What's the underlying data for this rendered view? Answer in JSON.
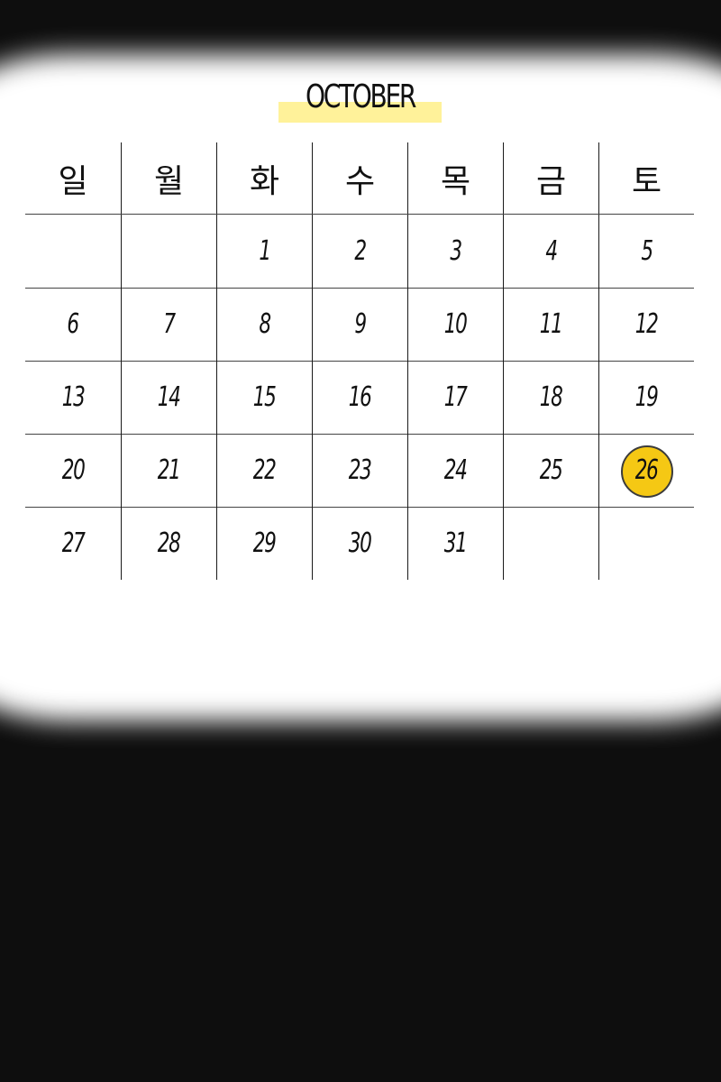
{
  "calendar": {
    "month": "OCTOBER",
    "weekdays": [
      "일",
      "월",
      "화",
      "수",
      "목",
      "금",
      "토"
    ],
    "weeks": [
      [
        "",
        "",
        "1",
        "2",
        "3",
        "4",
        "5"
      ],
      [
        "6",
        "7",
        "8",
        "9",
        "10",
        "11",
        "12"
      ],
      [
        "13",
        "14",
        "15",
        "16",
        "17",
        "18",
        "19"
      ],
      [
        "20",
        "21",
        "22",
        "23",
        "24",
        "25",
        "26"
      ],
      [
        "27",
        "28",
        "29",
        "30",
        "31",
        "",
        ""
      ]
    ],
    "highlighted_day": "26",
    "colors": {
      "background": "#0e0e0e",
      "paper": "#ffffff",
      "title_highlight": "#fff29a",
      "today_circle": "#f5c814",
      "ink": "#111111"
    }
  }
}
